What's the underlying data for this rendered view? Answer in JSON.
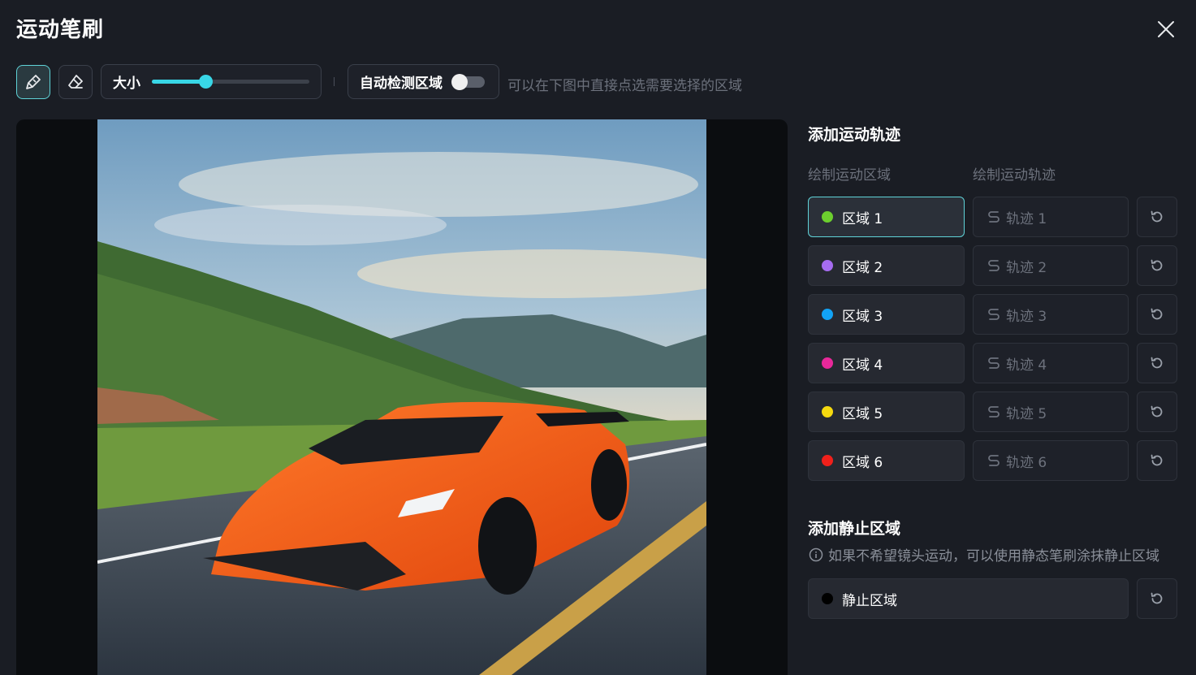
{
  "header": {
    "title": "运动笔刷"
  },
  "toolbar": {
    "size_label": "大小",
    "size_value": 0.34,
    "detect_label": "自动检测区域",
    "detect_enabled": false,
    "hint": "可以在下图中直接点选需要选择的区域"
  },
  "motion": {
    "title": "添加运动轨迹",
    "col_regions": "绘制运动区域",
    "col_tracks": "绘制运动轨迹",
    "rows": [
      {
        "region": "区域 1",
        "track": "轨迹 1",
        "color": "#6ccf2e"
      },
      {
        "region": "区域 2",
        "track": "轨迹 2",
        "color": "#a66cf0"
      },
      {
        "region": "区域 3",
        "track": "轨迹 3",
        "color": "#12a3f5"
      },
      {
        "region": "区域 4",
        "track": "轨迹 4",
        "color": "#e8289a"
      },
      {
        "region": "区域 5",
        "track": "轨迹 5",
        "color": "#f5d90f"
      },
      {
        "region": "区域 6",
        "track": "轨迹 6",
        "color": "#f0201b"
      }
    ]
  },
  "static": {
    "title": "添加静止区域",
    "hint": "如果不希望镜头运动，可以使用静态笔刷涂抹静止区域",
    "region": "静止区域",
    "color": "#000000"
  },
  "icons": {
    "brush": "brush-icon",
    "eraser": "eraser-icon",
    "close": "close-icon",
    "track": "track-s-icon",
    "reset": "reset-icon",
    "info": "info-icon"
  },
  "colors": {
    "accent": "#38d6e6",
    "selected_border": "#5fd3d8"
  }
}
